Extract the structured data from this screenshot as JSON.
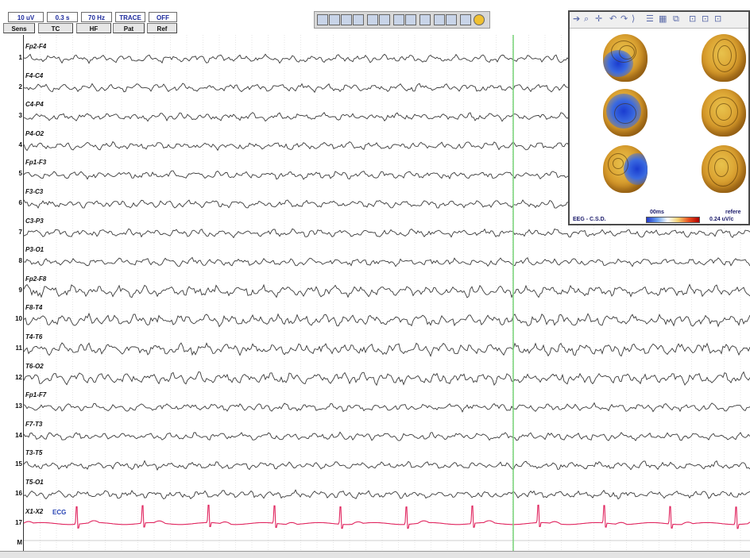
{
  "controls": {
    "sensitivity": "10 uV",
    "time_constant": "0.3 s",
    "high_filter": "70 Hz",
    "trace": "TRACE",
    "state": "OFF",
    "buttons": [
      "Sens",
      "TC",
      "HF",
      "Pat",
      "Ref"
    ]
  },
  "channels": [
    {
      "num": "1",
      "label": "Fp2-F4"
    },
    {
      "num": "2",
      "label": "F4-C4"
    },
    {
      "num": "3",
      "label": "C4-P4"
    },
    {
      "num": "4",
      "label": "P4-O2"
    },
    {
      "num": "5",
      "label": "Fp1-F3"
    },
    {
      "num": "6",
      "label": "F3-C3"
    },
    {
      "num": "7",
      "label": "C3-P3"
    },
    {
      "num": "8",
      "label": "P3-O1"
    },
    {
      "num": "9",
      "label": "Fp2-F8"
    },
    {
      "num": "10",
      "label": "F8-T4"
    },
    {
      "num": "11",
      "label": "T4-T6"
    },
    {
      "num": "12",
      "label": "T6-O2"
    },
    {
      "num": "13",
      "label": "Fp1-F7"
    },
    {
      "num": "14",
      "label": "F7-T3"
    },
    {
      "num": "15",
      "label": "T3-T5"
    },
    {
      "num": "16",
      "label": "T5-O1"
    },
    {
      "num": "17",
      "label": "X1-X2"
    }
  ],
  "marker_channel": "M",
  "ecg_tag": "ECG",
  "colors": {
    "eeg_trace": "#3a3a3a",
    "ecg_trace": "#e0245e",
    "cursor": "#7fd67f",
    "label_blue": "#2844b4"
  },
  "map_window": {
    "latency": "00ms",
    "mode_right": "refere",
    "title": "EEG - C.S.D.",
    "scale_value": "0.24 uV/c"
  }
}
